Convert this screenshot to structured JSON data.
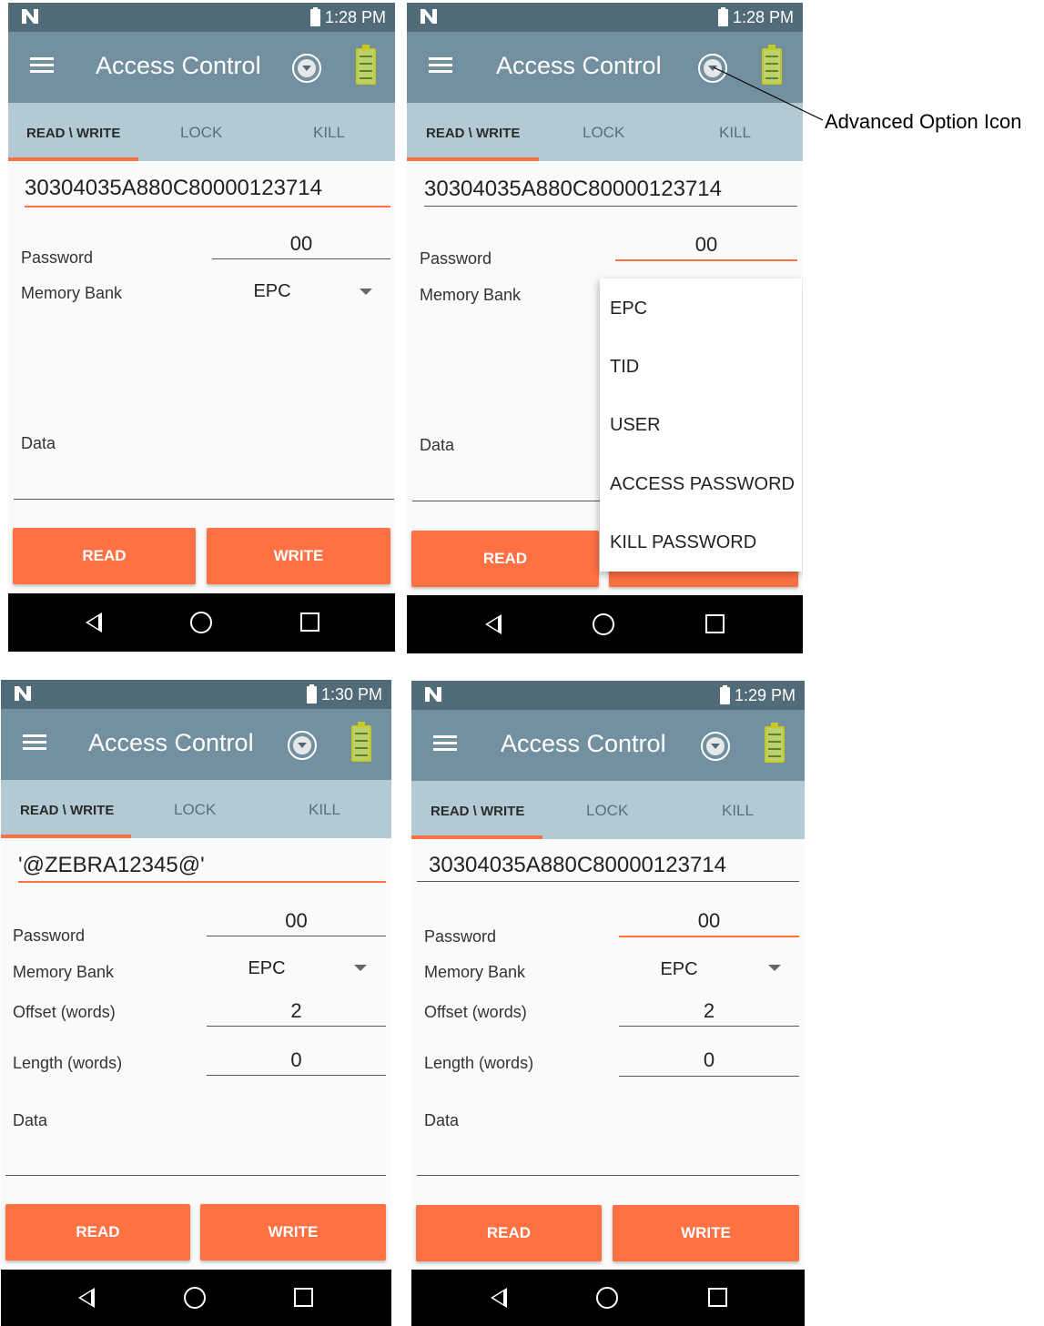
{
  "colors": {
    "status_bar": "#516b79",
    "app_bar": "#7390a0",
    "tab_bar": "#b3cad5",
    "accent": "#ff7043",
    "nav_bar": "#000000"
  },
  "icons": [
    "n-logo-icon",
    "battery-status-icon",
    "hamburger-menu-icon",
    "advanced-option-icon",
    "battery-level-icon",
    "back-icon",
    "home-icon",
    "recents-icon"
  ],
  "callout": {
    "label": "Advanced Option Icon"
  },
  "screens": [
    {
      "time": "1:28 PM",
      "title": "Access Control",
      "tabs": [
        "READ \\ WRITE",
        "LOCK",
        "KILL"
      ],
      "tag": "30304035A880C80000123714",
      "password_label": "Password",
      "password": "00",
      "memory_bank_label": "Memory Bank",
      "memory_bank": "EPC",
      "data_label": "Data",
      "read": "READ",
      "write": "WRITE"
    },
    {
      "time": "1:28 PM",
      "title": "Access Control",
      "tabs": [
        "READ \\ WRITE",
        "LOCK",
        "KILL"
      ],
      "tag": "30304035A880C80000123714",
      "password_label": "Password",
      "password": "00",
      "memory_bank_label": "Memory Bank",
      "data_label": "Data",
      "read": "READ",
      "dropdown_options": [
        "EPC",
        "TID",
        "USER",
        "ACCESS PASSWORD",
        "KILL PASSWORD"
      ]
    },
    {
      "time": "1:30 PM",
      "title": "Access Control",
      "tabs": [
        "READ \\ WRITE",
        "LOCK",
        "KILL"
      ],
      "tag": "'@ZEBRA12345@'",
      "password_label": "Password",
      "password": "00",
      "memory_bank_label": "Memory Bank",
      "memory_bank": "EPC",
      "offset_label": "Offset (words)",
      "offset": "2",
      "length_label": "Length (words)",
      "length": "0",
      "data_label": "Data",
      "read": "READ",
      "write": "WRITE"
    },
    {
      "time": "1:29 PM",
      "title": "Access Control",
      "tabs": [
        "READ \\ WRITE",
        "LOCK",
        "KILL"
      ],
      "tag": "30304035A880C80000123714",
      "password_label": "Password",
      "password": "00",
      "memory_bank_label": "Memory Bank",
      "memory_bank": "EPC",
      "offset_label": "Offset (words)",
      "offset": "2",
      "length_label": "Length (words)",
      "length": "0",
      "data_label": "Data",
      "read": "READ",
      "write": "WRITE"
    }
  ]
}
